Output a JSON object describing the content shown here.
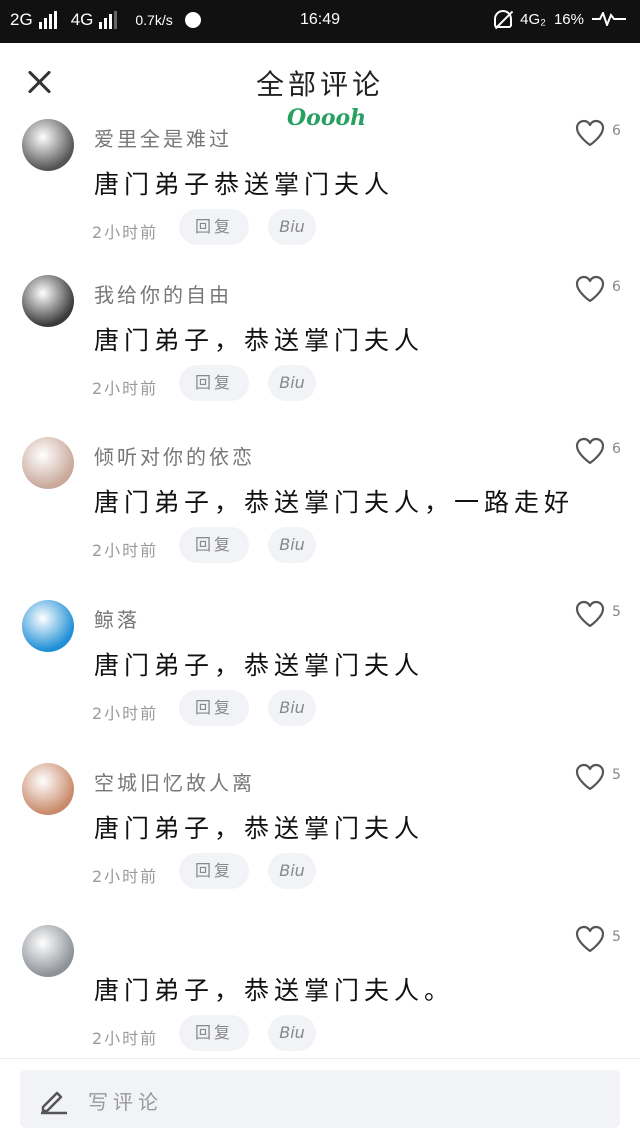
{
  "status_bar": {
    "net1": "2G",
    "net2": "4G",
    "speed": "0.7k/s",
    "time": "16:49",
    "right_net": "4G₂",
    "battery": "16%"
  },
  "header": {
    "title": "全部评论",
    "sticker": "Ooooh"
  },
  "actions": {
    "reply_label": "回复",
    "biu_label": "Biu"
  },
  "comments": [
    {
      "username": "爱里全是难过",
      "content": "唐门弟子恭送掌门夫人",
      "time": "2小时前",
      "likes": "6",
      "avatar_color": "#555555"
    },
    {
      "username": "我给你的自由",
      "content": "唐门弟子，恭送掌门夫人",
      "time": "2小时前",
      "likes": "6",
      "avatar_color": "#3a3a3a"
    },
    {
      "username": "倾听对你的依恋",
      "content": "唐门弟子，恭送掌门夫人，一路走好",
      "time": "2小时前",
      "likes": "6",
      "avatar_color": "#c9a89a"
    },
    {
      "username": "鲸落",
      "content": "唐门弟子，恭送掌门夫人",
      "time": "2小时前",
      "likes": "5",
      "avatar_color": "#1f8fd6"
    },
    {
      "username": "空城旧忆故人离",
      "content": "唐门弟子，恭送掌门夫人",
      "time": "2小时前",
      "likes": "5",
      "avatar_color": "#c98a6a"
    },
    {
      "username": "",
      "content": "唐门弟子，恭送掌门夫人。",
      "time": "2小时前",
      "likes": "5",
      "avatar_color": "#8d9298"
    }
  ],
  "composer": {
    "placeholder": "写评论"
  }
}
